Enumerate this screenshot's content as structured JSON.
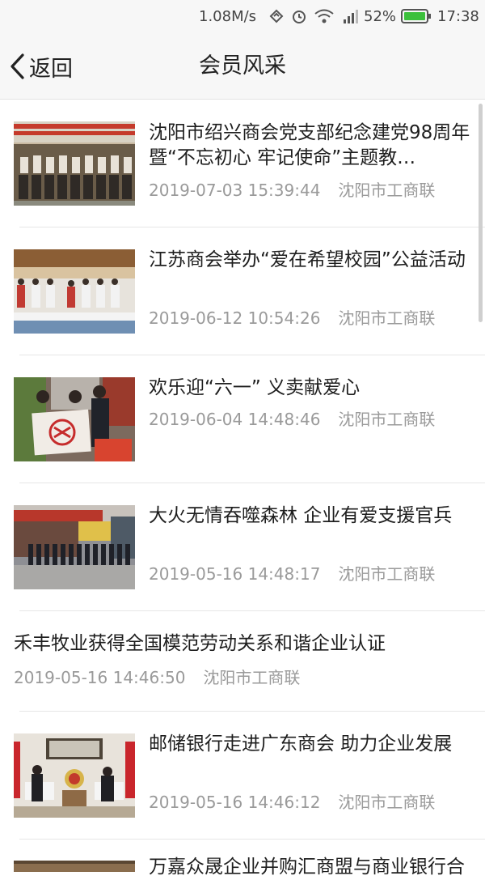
{
  "status_bar": {
    "speed": "1.08M/s",
    "battery": "52%",
    "time": "17:38"
  },
  "header": {
    "back_label": "返回",
    "title": "会员风采"
  },
  "articles": [
    {
      "title": "沈阳市绍兴商会党支部纪念建党98周年暨“不忘初心 牢记使命”主题教…",
      "date": "2019-07-03 15:39:44",
      "source": "沈阳市工商联",
      "image": "group-photo-banner"
    },
    {
      "title": "江苏商会举办“爱在希望校园”公益活动",
      "date": "2019-06-12 10:54:26",
      "source": "沈阳市工商联",
      "image": "ceremony-stage-photo"
    },
    {
      "title": "欢乐迎“六一” 义卖献爱心",
      "date": "2019-06-04 14:48:46",
      "source": "沈阳市工商联",
      "image": "charity-sale-photo"
    },
    {
      "title": "大火无情吞噬森林 企业有爱支援官兵",
      "date": "2019-05-16 14:48:17",
      "source": "沈阳市工商联",
      "image": "soldiers-street-photo"
    },
    {
      "title": "禾丰牧业获得全国模范劳动关系和谐企业认证",
      "date": "2019-05-16 14:46:50",
      "source": "沈阳市工商联",
      "image": ""
    },
    {
      "title": "邮储银行走进广东商会 助力企业发展",
      "date": "2019-05-16 14:46:12",
      "source": "沈阳市工商联",
      "image": "meeting-room-photo"
    },
    {
      "title": "万嘉众晟企业并购汇商盟与商业银行合",
      "date": "",
      "source": "",
      "image": ""
    }
  ]
}
